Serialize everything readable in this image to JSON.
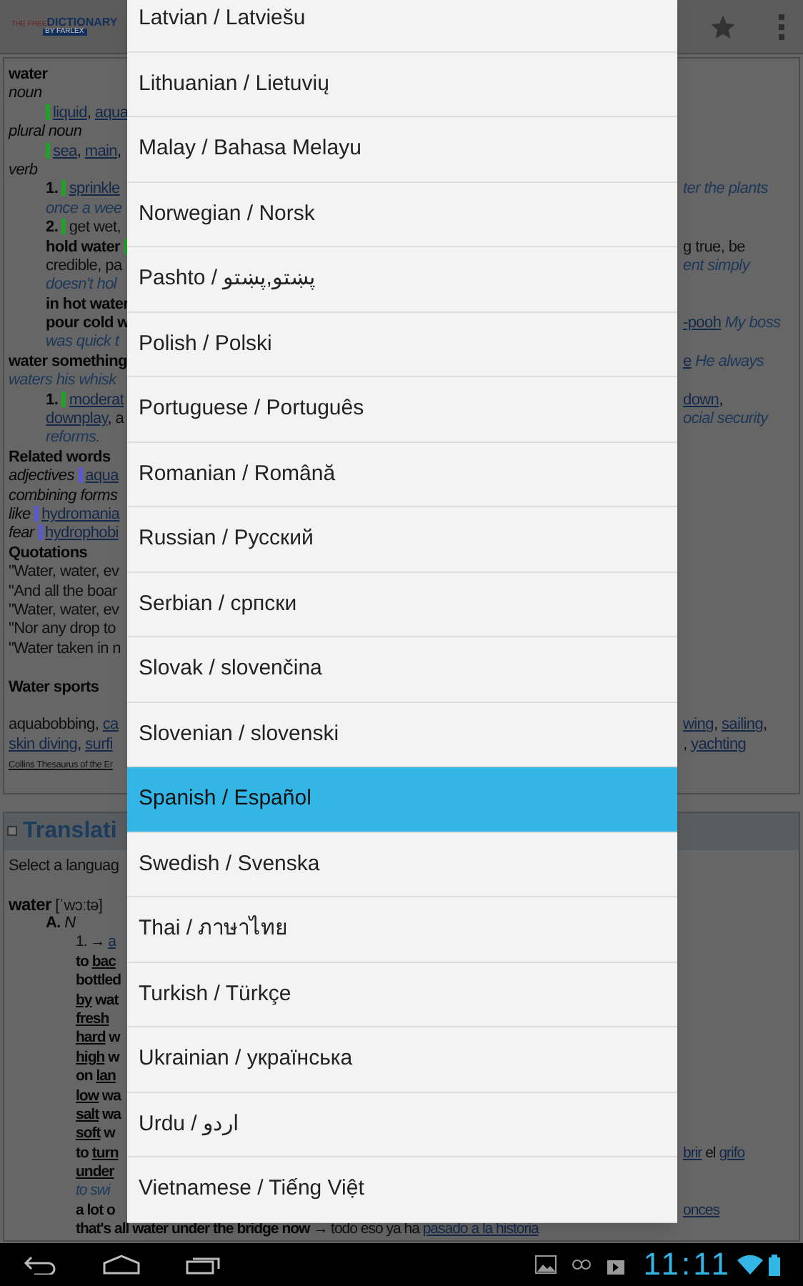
{
  "logo": {
    "prefix": "THE FREE",
    "name": "DICTIONARY",
    "by": "BY FARLEX"
  },
  "entry": [
    {
      "kind": "flush",
      "left": [
        {
          "kind": "b",
          "text": "water"
        }
      ]
    },
    {
      "kind": "flush",
      "left": [
        {
          "kind": "em",
          "text": "noun"
        }
      ]
    },
    {
      "kind": "indent",
      "left": [
        {
          "kind": "bar",
          "color": "#22a02a"
        },
        {
          "kind": "l",
          "text": "liquid"
        },
        {
          "kind": "t",
          "text": ", "
        },
        {
          "kind": "l",
          "text": "aqua"
        }
      ]
    },
    {
      "kind": "flush",
      "left": [
        {
          "kind": "em",
          "text": "plural noun"
        }
      ]
    },
    {
      "kind": "indent",
      "left": [
        {
          "kind": "bar",
          "color": "#22a02a"
        },
        {
          "kind": "l",
          "text": "sea"
        },
        {
          "kind": "t",
          "text": ", "
        },
        {
          "kind": "l",
          "text": "main"
        },
        {
          "kind": "t",
          "text": ","
        }
      ]
    },
    {
      "kind": "flush",
      "left": [
        {
          "kind": "em",
          "text": "verb"
        }
      ]
    },
    {
      "kind": "indent",
      "left": [
        {
          "kind": "b",
          "text": "1. "
        },
        {
          "kind": "bar",
          "color": "#22a02a"
        },
        {
          "kind": "l",
          "text": "sprinkle"
        }
      ],
      "right": [
        {
          "kind": "ex",
          "text": "ter the plants"
        }
      ]
    },
    {
      "kind": "indent",
      "left": [
        {
          "kind": "ex",
          "text": "once a wee"
        }
      ]
    },
    {
      "kind": "indent",
      "left": [
        {
          "kind": "b",
          "text": "2. "
        },
        {
          "kind": "bar",
          "color": "#22a02a"
        },
        {
          "kind": "t",
          "text": "get wet,"
        }
      ]
    },
    {
      "kind": "indent",
      "left": [
        {
          "kind": "b",
          "text": "hold water "
        },
        {
          "kind": "bar",
          "color": "#22a02a"
        }
      ],
      "right": [
        {
          "kind": "t",
          "text": "g true, be"
        }
      ]
    },
    {
      "kind": "indent",
      "left": [
        {
          "kind": "t",
          "text": "credible, pa"
        }
      ],
      "right": [
        {
          "kind": "ex",
          "text": "ent simply"
        }
      ]
    },
    {
      "kind": "indent",
      "left": [
        {
          "kind": "ex",
          "text": "doesn't hol"
        }
      ]
    },
    {
      "kind": "indent",
      "left": [
        {
          "kind": "b",
          "text": "in hot water"
        }
      ]
    },
    {
      "kind": "indent",
      "left": [
        {
          "kind": "b",
          "text": "pour cold w"
        }
      ],
      "right": [
        {
          "kind": "l",
          "text": "-pooh"
        },
        {
          "kind": "ex",
          "text": " My boss"
        }
      ]
    },
    {
      "kind": "indent",
      "left": [
        {
          "kind": "ex",
          "text": "was quick t"
        }
      ]
    },
    {
      "kind": "flush",
      "left": [
        {
          "kind": "b",
          "text": "water something"
        }
      ],
      "right": [
        {
          "kind": "l",
          "text": "e"
        },
        {
          "kind": "ex",
          "text": " He always"
        }
      ]
    },
    {
      "kind": "flush",
      "left": [
        {
          "kind": "ex",
          "text": "waters his whisk"
        }
      ]
    },
    {
      "kind": "indent",
      "left": [
        {
          "kind": "b",
          "text": "1. "
        },
        {
          "kind": "bar",
          "color": "#22a02a"
        },
        {
          "kind": "l",
          "text": "moderat"
        }
      ],
      "right": [
        {
          "kind": "l",
          "text": "down"
        },
        {
          "kind": "t",
          "text": ","
        }
      ]
    },
    {
      "kind": "indent",
      "left": [
        {
          "kind": "l",
          "text": "downplay"
        },
        {
          "kind": "t",
          "text": ", a"
        }
      ],
      "right": [
        {
          "kind": "ex",
          "text": "ocial security"
        }
      ]
    },
    {
      "kind": "indent",
      "left": [
        {
          "kind": "ex",
          "text": "reforms."
        }
      ]
    },
    {
      "kind": "flush",
      "left": [
        {
          "kind": "b",
          "text": "Related words"
        }
      ]
    },
    {
      "kind": "flush",
      "left": [
        {
          "kind": "em",
          "text": "adjectives "
        },
        {
          "kind": "bar",
          "color": "#5a5ad0"
        },
        {
          "kind": "l",
          "text": "aqua"
        }
      ]
    },
    {
      "kind": "flush",
      "left": [
        {
          "kind": "em",
          "text": "combining forms"
        }
      ]
    },
    {
      "kind": "flush",
      "left": [
        {
          "kind": "em",
          "text": "like "
        },
        {
          "kind": "bar",
          "color": "#5a5ad0"
        },
        {
          "kind": "l",
          "text": "hydromania"
        }
      ]
    },
    {
      "kind": "flush",
      "left": [
        {
          "kind": "em",
          "text": "fear "
        },
        {
          "kind": "bar",
          "color": "#5a5ad0"
        },
        {
          "kind": "l",
          "text": "hydrophobi"
        }
      ]
    },
    {
      "kind": "flush",
      "left": [
        {
          "kind": "b",
          "text": "Quotations"
        }
      ]
    },
    {
      "kind": "flush",
      "left": [
        {
          "kind": "t",
          "text": "\"Water, water, ev"
        }
      ]
    },
    {
      "kind": "flush",
      "left": [
        {
          "kind": "t",
          "text": "\"And all the boar"
        }
      ]
    },
    {
      "kind": "flush",
      "left": [
        {
          "kind": "t",
          "text": "\"Water, water, ev"
        }
      ]
    },
    {
      "kind": "flush",
      "left": [
        {
          "kind": "t",
          "text": "\"Nor any drop to"
        }
      ]
    },
    {
      "kind": "flush",
      "left": [
        {
          "kind": "t",
          "text": "\"Water taken in n"
        }
      ]
    },
    {
      "kind": "gap"
    },
    {
      "kind": "flush",
      "left": [
        {
          "kind": "b",
          "text": "Water sports"
        }
      ]
    },
    {
      "kind": "gap"
    },
    {
      "kind": "flush",
      "left": [
        {
          "kind": "t",
          "text": "aquabobbing, "
        },
        {
          "kind": "l",
          "text": "ca"
        }
      ],
      "right": [
        {
          "kind": "l",
          "text": "wing"
        },
        {
          "kind": "t",
          "text": ", "
        },
        {
          "kind": "l",
          "text": "sailing"
        },
        {
          "kind": "t",
          "text": ","
        }
      ]
    },
    {
      "kind": "flush",
      "left": [
        {
          "kind": "l",
          "text": "skin diving"
        },
        {
          "kind": "t",
          "text": ", "
        },
        {
          "kind": "l",
          "text": "surfi"
        }
      ],
      "right": [
        {
          "kind": "t",
          "text": ", "
        },
        {
          "kind": "l",
          "text": "yachting"
        }
      ]
    },
    {
      "kind": "flush",
      "left": [
        {
          "kind": "small",
          "text": "Collins Thesaurus of the Er"
        }
      ]
    },
    {
      "kind": "gap"
    }
  ],
  "translation": {
    "title": "Translati",
    "lines": [
      {
        "kind": "flush",
        "left": [
          {
            "kind": "t",
            "text": "Select a languag"
          }
        ]
      },
      {
        "kind": "gap"
      },
      {
        "kind": "flush",
        "left": [
          {
            "kind": "bb",
            "text": "water"
          },
          {
            "kind": "t",
            "text": " [ˈwɔːtə]"
          }
        ]
      },
      {
        "kind": "indent",
        "left": [
          {
            "kind": "b",
            "text": "A. "
          },
          {
            "kind": "em",
            "text": "N"
          }
        ]
      },
      {
        "kind": "deep",
        "left": [
          {
            "kind": "t",
            "text": "1. → "
          },
          {
            "kind": "l",
            "text": "a"
          }
        ]
      },
      {
        "kind": "deep",
        "left": [
          {
            "kind": "b",
            "text": "to "
          },
          {
            "kind": "u",
            "text": "bac"
          }
        ]
      },
      {
        "kind": "deep",
        "left": [
          {
            "kind": "b",
            "text": "bottled"
          }
        ]
      },
      {
        "kind": "deep",
        "left": [
          {
            "kind": "u",
            "text": "by"
          },
          {
            "kind": "b",
            "text": " wat"
          }
        ]
      },
      {
        "kind": "deep",
        "left": [
          {
            "kind": "u",
            "text": "fresh"
          }
        ]
      },
      {
        "kind": "deep",
        "left": [
          {
            "kind": "u",
            "text": "hard"
          },
          {
            "kind": "b",
            "text": " w"
          }
        ]
      },
      {
        "kind": "deep",
        "left": [
          {
            "kind": "u",
            "text": "high"
          },
          {
            "kind": "b",
            "text": " w"
          }
        ]
      },
      {
        "kind": "deep",
        "left": [
          {
            "kind": "b",
            "text": "on "
          },
          {
            "kind": "u",
            "text": "lan"
          }
        ]
      },
      {
        "kind": "deep",
        "left": [
          {
            "kind": "u",
            "text": "low"
          },
          {
            "kind": "b",
            "text": " wa"
          }
        ]
      },
      {
        "kind": "deep",
        "left": [
          {
            "kind": "u",
            "text": "salt"
          },
          {
            "kind": "b",
            "text": " wa"
          }
        ]
      },
      {
        "kind": "deep",
        "left": [
          {
            "kind": "u",
            "text": "soft"
          },
          {
            "kind": "b",
            "text": " w"
          }
        ]
      },
      {
        "kind": "deep",
        "left": [
          {
            "kind": "b",
            "text": "to "
          },
          {
            "kind": "u",
            "text": "turn"
          }
        ],
        "right": [
          {
            "kind": "l",
            "text": "brir"
          },
          {
            "kind": "t",
            "text": " el "
          },
          {
            "kind": "l",
            "text": "grifo"
          }
        ]
      },
      {
        "kind": "deep",
        "left": [
          {
            "kind": "u",
            "text": "under"
          }
        ]
      },
      {
        "kind": "deep",
        "left": [
          {
            "kind": "ex",
            "text": "to swi"
          }
        ]
      },
      {
        "kind": "deep",
        "left": [
          {
            "kind": "b",
            "text": "a lot o"
          }
        ],
        "right": [
          {
            "kind": "l",
            "text": "onces"
          }
        ]
      },
      {
        "kind": "deep",
        "left": [
          {
            "kind": "b",
            "text": "that's all water under the bridge now"
          },
          {
            "kind": "t",
            "text": " → todo eso ya ha "
          },
          {
            "kind": "l",
            "text": "pasado a la historia"
          }
        ]
      }
    ]
  },
  "languages": [
    {
      "label": "Latvian / Latviešu",
      "selected": false
    },
    {
      "label": "Lithuanian / Lietuvių",
      "selected": false
    },
    {
      "label": "Malay / Bahasa Melayu",
      "selected": false
    },
    {
      "label": "Norwegian / Norsk",
      "selected": false
    },
    {
      "label": "Pashto / پښتو,پښتو",
      "selected": false
    },
    {
      "label": "Polish / Polski",
      "selected": false
    },
    {
      "label": "Portuguese / Português",
      "selected": false
    },
    {
      "label": "Romanian / Română",
      "selected": false
    },
    {
      "label": "Russian / Русский",
      "selected": false
    },
    {
      "label": "Serbian / српски",
      "selected": false
    },
    {
      "label": "Slovak / slovenčina",
      "selected": false
    },
    {
      "label": "Slovenian / slovenski",
      "selected": false
    },
    {
      "label": "Spanish / Español",
      "selected": true
    },
    {
      "label": "Swedish / Svenska",
      "selected": false
    },
    {
      "label": "Thai / ภาษาไทย",
      "selected": false
    },
    {
      "label": "Turkish / Türkçe",
      "selected": false
    },
    {
      "label": "Ukrainian / українська",
      "selected": false
    },
    {
      "label": "Urdu / اردو",
      "selected": false
    },
    {
      "label": "Vietnamese / Tiếng Việt",
      "selected": false
    }
  ],
  "status_bar": {
    "time": "11:11"
  }
}
